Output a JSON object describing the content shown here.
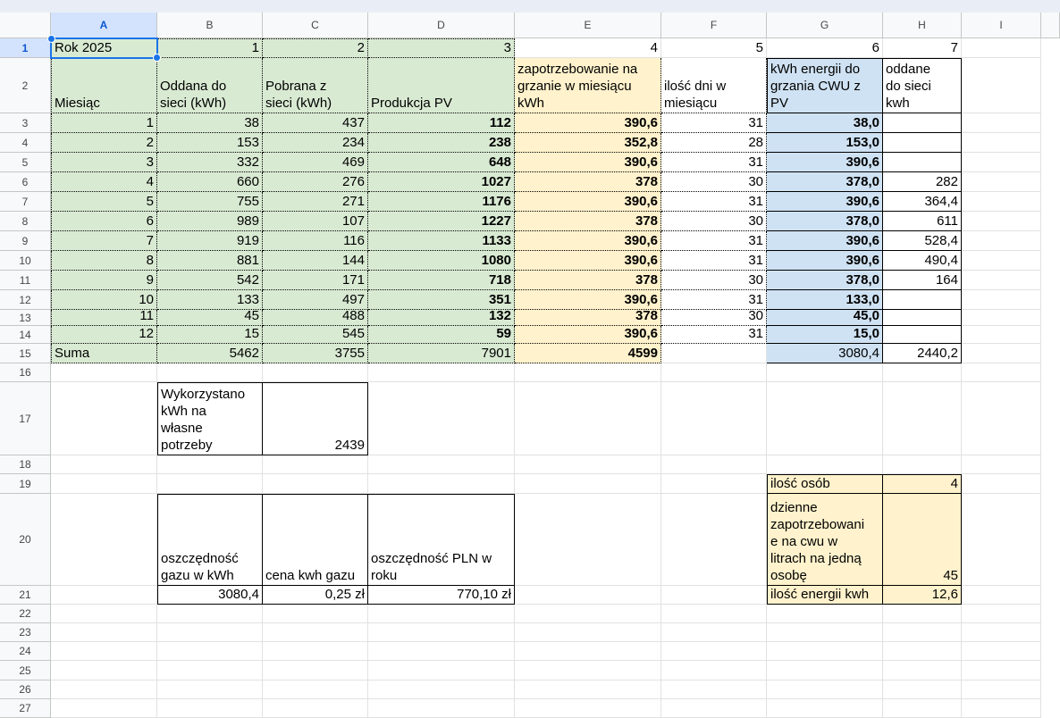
{
  "columns": [
    "A",
    "B",
    "C",
    "D",
    "E",
    "F",
    "G",
    "H",
    "I"
  ],
  "rows": [
    "1",
    "2",
    "3",
    "4",
    "5",
    "6",
    "7",
    "8",
    "9",
    "10",
    "11",
    "12",
    "13",
    "14",
    "15",
    "16",
    "17",
    "18",
    "19",
    "20",
    "21",
    "22",
    "23",
    "24",
    "25",
    "26",
    "27"
  ],
  "selected_cell": "A1",
  "colors": {
    "green": "#d9ead3",
    "yellow": "#fff2cc",
    "blue": "#cfe2f3",
    "selection": "#1a73e8"
  },
  "row1": {
    "a": "Rok 2025",
    "b": "1",
    "c": "2",
    "d": "3",
    "e": "4",
    "f": "5",
    "g": "6",
    "h": "7"
  },
  "row2": {
    "a": "Miesiąc",
    "b": [
      "Oddana do",
      "sieci (kWh)"
    ],
    "c": [
      "Pobrana z",
      "sieci (kWh)"
    ],
    "d": "Produkcja PV",
    "e": [
      "zapotrzebowanie na",
      "grzanie w miesiącu",
      "kWh"
    ],
    "f": [
      "ilość dni w",
      "miesiącu"
    ],
    "g": [
      "kWh energii do",
      "grzania CWU z",
      "PV"
    ],
    "h": [
      "oddane",
      "do sieci",
      "kwh"
    ]
  },
  "months": [
    {
      "m": "1",
      "b": "38",
      "c": "437",
      "d": "112",
      "e": "390,6",
      "f": "31",
      "g": "38,0",
      "h": ""
    },
    {
      "m": "2",
      "b": "153",
      "c": "234",
      "d": "238",
      "e": "352,8",
      "f": "28",
      "g": "153,0",
      "h": ""
    },
    {
      "m": "3",
      "b": "332",
      "c": "469",
      "d": "648",
      "e": "390,6",
      "f": "31",
      "g": "390,6",
      "h": ""
    },
    {
      "m": "4",
      "b": "660",
      "c": "276",
      "d": "1027",
      "e": "378",
      "f": "30",
      "g": "378,0",
      "h": "282"
    },
    {
      "m": "5",
      "b": "755",
      "c": "271",
      "d": "1176",
      "e": "390,6",
      "f": "31",
      "g": "390,6",
      "h": "364,4"
    },
    {
      "m": "6",
      "b": "989",
      "c": "107",
      "d": "1227",
      "e": "378",
      "f": "30",
      "g": "378,0",
      "h": "611"
    },
    {
      "m": "7",
      "b": "919",
      "c": "116",
      "d": "1133",
      "e": "390,6",
      "f": "31",
      "g": "390,6",
      "h": "528,4"
    },
    {
      "m": "8",
      "b": "881",
      "c": "144",
      "d": "1080",
      "e": "390,6",
      "f": "31",
      "g": "390,6",
      "h": "490,4"
    },
    {
      "m": "9",
      "b": "542",
      "c": "171",
      "d": "718",
      "e": "378",
      "f": "30",
      "g": "378,0",
      "h": "164"
    },
    {
      "m": "10",
      "b": "133",
      "c": "497",
      "d": "351",
      "e": "390,6",
      "f": "31",
      "g": "133,0",
      "h": ""
    },
    {
      "m": "11",
      "b": "45",
      "c": "488",
      "d": "132",
      "e": "378",
      "f": "30",
      "g": "45,0",
      "h": ""
    },
    {
      "m": "12",
      "b": "15",
      "c": "545",
      "d": "59",
      "e": "390,6",
      "f": "31",
      "g": "15,0",
      "h": ""
    }
  ],
  "row15": {
    "a": "Suma",
    "b": "5462",
    "c": "3755",
    "d": "7901",
    "e": "4599",
    "g": "3080,4",
    "h": "2440,2"
  },
  "row17": {
    "b": [
      "Wykorzystano",
      "kWh na",
      "własne",
      "potrzeby"
    ],
    "c": "2439"
  },
  "row19": {
    "g": "ilość osób",
    "h": "4"
  },
  "row20": {
    "b": [
      "oszczędność",
      "gazu w kWh"
    ],
    "c": "cena kwh gazu",
    "d": [
      "oszczędność PLN w",
      "roku"
    ],
    "g": [
      "dzienne",
      "zapotrzebowani",
      "e na cwu w",
      "litrach na jedną",
      "osobę"
    ],
    "h": "45"
  },
  "row21": {
    "b": "3080,4",
    "c": "0,25 zł",
    "d": "770,10 zł",
    "g": "ilość energii kwh",
    "h": "12,6"
  }
}
